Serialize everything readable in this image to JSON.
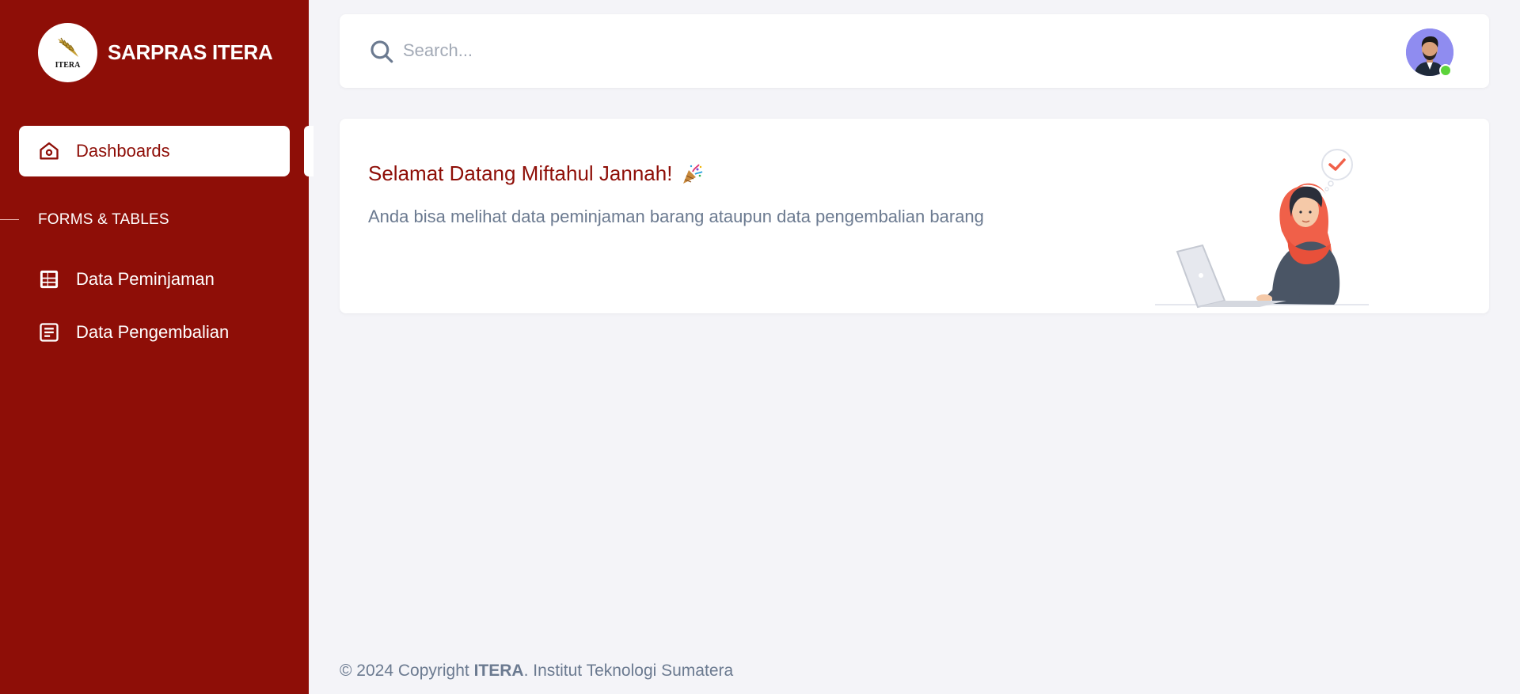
{
  "brand": {
    "name": "SARPRAS ITERA",
    "logo_text": "ITERA"
  },
  "sidebar": {
    "active_item": {
      "label": "Dashboards",
      "icon": "home-icon"
    },
    "section_title": "FORMS & TABLES",
    "items": [
      {
        "label": "Data Peminjaman",
        "icon": "table-grid-icon"
      },
      {
        "label": "Data Pengembalian",
        "icon": "document-list-icon"
      }
    ]
  },
  "search": {
    "placeholder": "Search..."
  },
  "user": {
    "avatar": "user-avatar",
    "status": "online"
  },
  "welcome": {
    "title": "Selamat Datang Miftahul Jannah!",
    "emoji": "party-popper-icon",
    "text": "Anda bisa melihat data peminjaman barang ataupun data pengembalian barang"
  },
  "footer": {
    "prefix": "© 2024 Copyright ",
    "org": "ITERA",
    "suffix": ". Institut Teknologi Sumatera"
  },
  "colors": {
    "sidebar": "#8e0e07",
    "accent": "#8e0e07",
    "background": "#f4f4f8",
    "muted_text": "#6b7a90",
    "online": "#5cd33a"
  }
}
